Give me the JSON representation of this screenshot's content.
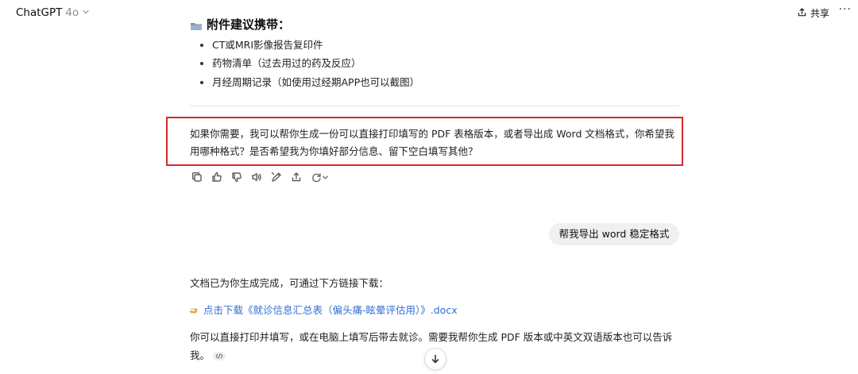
{
  "header": {
    "model_name": "ChatGPT",
    "model_version": "4o",
    "share_label": "共享",
    "more_label": "···"
  },
  "section": {
    "heading": "附件建议携带：",
    "icon": "folder-icon",
    "items": [
      "CT或MRI影像报告复印件",
      "药物清单（过去用过的药及反应）",
      "月经周期记录（如使用过经期APP也可以截图）"
    ]
  },
  "assistant_reply": {
    "text": "如果你需要，我可以帮你生成一份可以直接打印填写的 PDF 表格版本，或者导出成 Word 文档格式，你希望我用哪种格式？是否希望我为你填好部分信息、留下空白填写其他？",
    "highlight_color": "#d32a2a"
  },
  "actions": [
    "copy-icon",
    "thumbs-up-icon",
    "thumbs-down-icon",
    "read-aloud-icon",
    "edit-icon",
    "share-icon",
    "regenerate-icon"
  ],
  "user_message": "帮我导出 word 稳定格式",
  "response": {
    "status": "文档已为你生成完成，可通过下方链接下载：",
    "link_text": "点击下载《就诊信息汇总表（偏头痛-眩晕评估用）》.docx",
    "link_icon": "pointing-hand-icon",
    "closing": "你可以直接打印并填写，或在电脑上填写后带去就诊。需要我帮你生成 PDF 版本或中英文双语版本也可以告诉我。"
  },
  "colors": {
    "link": "#2d6fd6",
    "bubble": "#f0f0f0",
    "divider": "#e4e4e4"
  }
}
